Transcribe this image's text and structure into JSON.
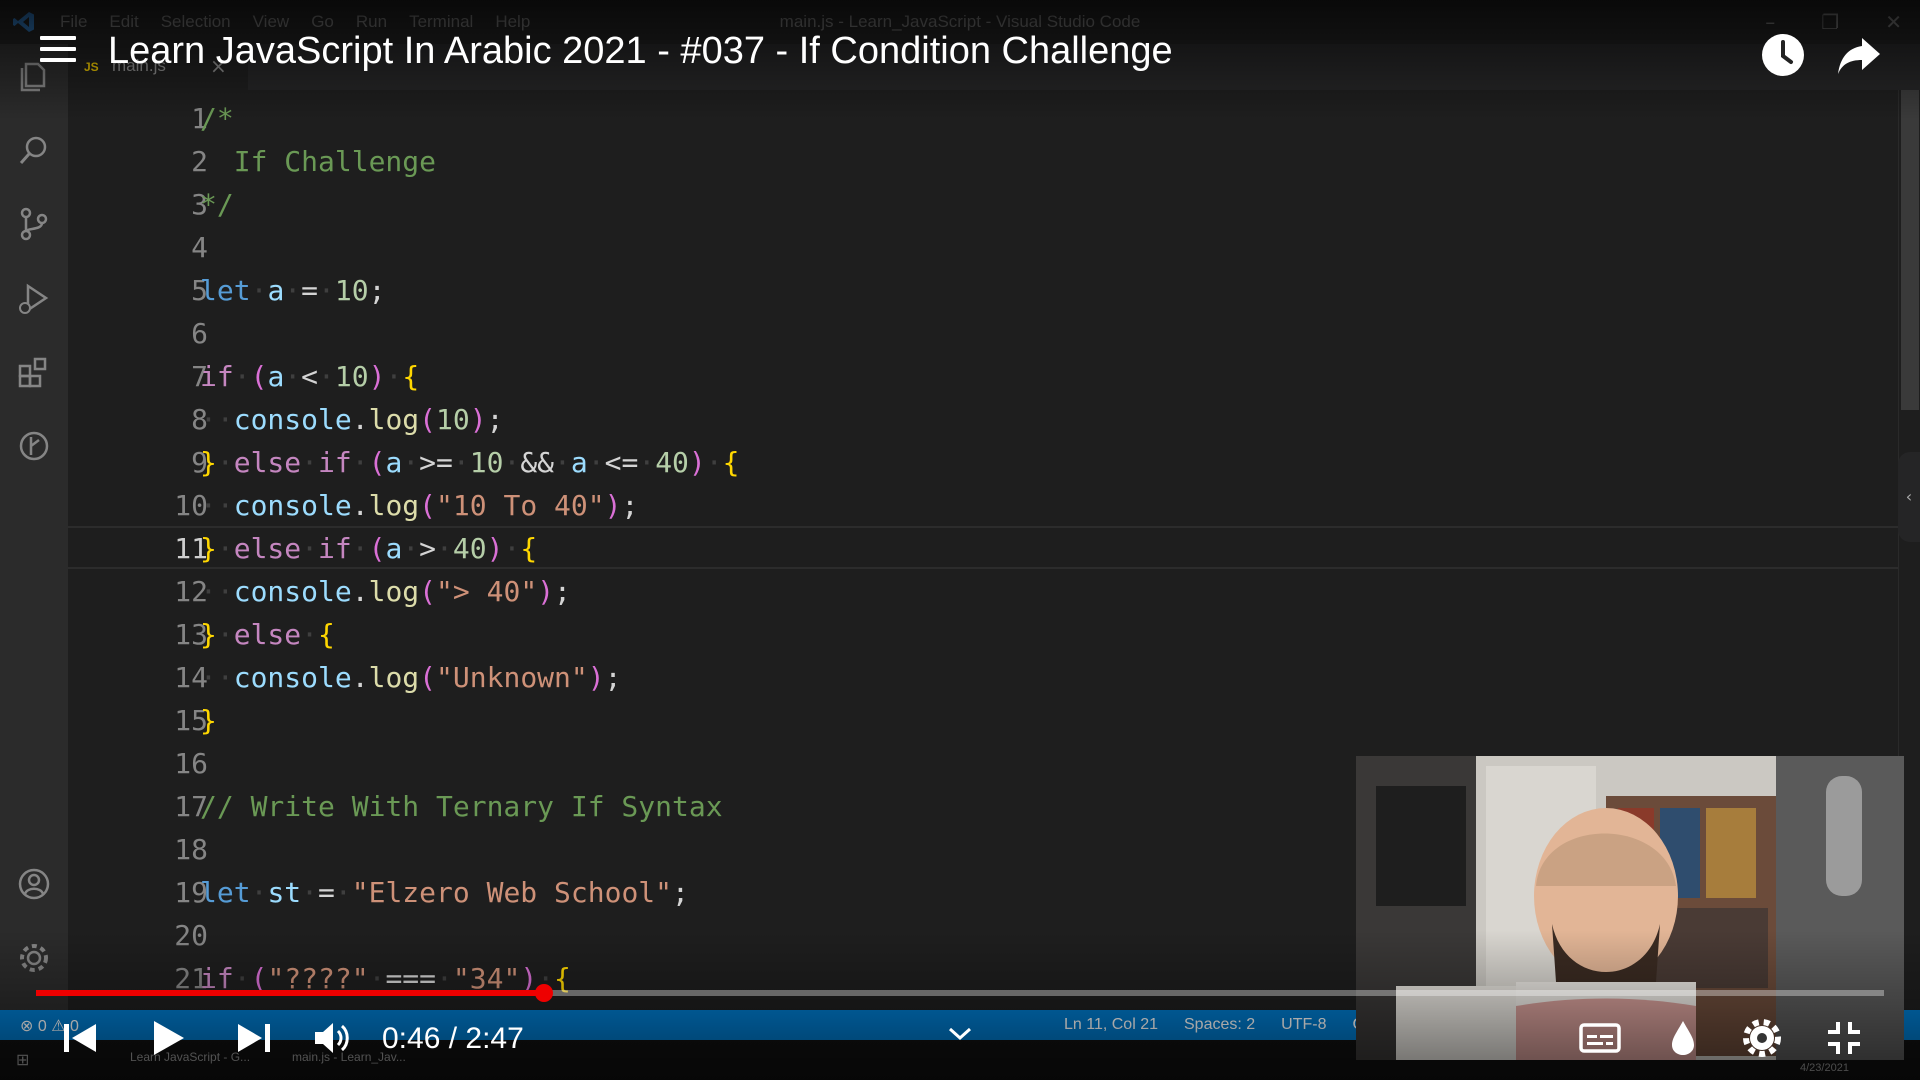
{
  "vscode": {
    "menu": [
      "File",
      "Edit",
      "Selection",
      "View",
      "Go",
      "Run",
      "Terminal",
      "Help"
    ],
    "window_title": "main.js - Learn_JavaScript - Visual Studio Code",
    "tab": {
      "badge": "JS",
      "name": "main.js",
      "close": "×"
    },
    "activity_icons": [
      "explorer-icon",
      "search-icon",
      "source-control-icon",
      "run-debug-icon",
      "extensions-icon",
      "git-history-icon",
      "account-icon",
      "settings-gear-icon"
    ],
    "code_lines": [
      {
        "n": "1",
        "t": "/*"
      },
      {
        "n": "2",
        "t": "  If Challenge"
      },
      {
        "n": "3",
        "t": "*/"
      },
      {
        "n": "4",
        "t": ""
      },
      {
        "n": "5",
        "t": "let a = 10;"
      },
      {
        "n": "6",
        "t": ""
      },
      {
        "n": "7",
        "t": "if (a < 10) {"
      },
      {
        "n": "8",
        "t": "  console.log(10);"
      },
      {
        "n": "9",
        "t": "} else if (a >= 10 && a <= 40) {"
      },
      {
        "n": "10",
        "t": "  console.log(\"10 To 40\");"
      },
      {
        "n": "11",
        "t": "} else if (a > 40) {"
      },
      {
        "n": "12",
        "t": "  console.log(\"> 40\");"
      },
      {
        "n": "13",
        "t": "} else {"
      },
      {
        "n": "14",
        "t": "  console.log(\"Unknown\");"
      },
      {
        "n": "15",
        "t": "}"
      },
      {
        "n": "16",
        "t": ""
      },
      {
        "n": "17",
        "t": "// Write With Ternary If Syntax"
      },
      {
        "n": "18",
        "t": ""
      },
      {
        "n": "19",
        "t": "let st = \"Elzero Web School\";"
      },
      {
        "n": "20",
        "t": ""
      },
      {
        "n": "21",
        "t": "if (\"????\" === \"34\") {"
      }
    ],
    "current_line": "11",
    "status": {
      "errors": "⊗ 0 ⚠ 0",
      "position": "Ln 11, Col 21",
      "spaces": "Spaces: 2",
      "encoding": "UTF-8",
      "eol": "C"
    },
    "taskbar": {
      "chrome_item": "Learn JavaScript - G...",
      "vscode_item": "main.js - Learn_Jav...",
      "date": "4/23/2021"
    }
  },
  "player": {
    "title": "Learn JavaScript In Arabic 2021 - #037 - If Condition Challenge",
    "current_time": "0:46",
    "duration": "2:47",
    "time_text": "0:46 / 2:47",
    "progress": 0.275,
    "accent_color": "#ee0000",
    "controls": [
      "previous-icon",
      "play-icon",
      "next-icon",
      "volume-icon",
      "chevron-down-icon",
      "subtitles-icon",
      "ambient-icon",
      "settings-icon",
      "exit-fullscreen-icon"
    ],
    "header_icons": [
      "menu-icon",
      "watch-later-icon",
      "share-icon"
    ]
  },
  "colors": {
    "editor_bg": "#1e1e1e",
    "status_bar": "#007acc",
    "keyword": "#569cd6",
    "control": "#c586c0",
    "variable": "#9cdcfe",
    "function": "#dcdcaa",
    "number": "#b5cea8",
    "string": "#ce9178",
    "comment": "#6a9955"
  }
}
